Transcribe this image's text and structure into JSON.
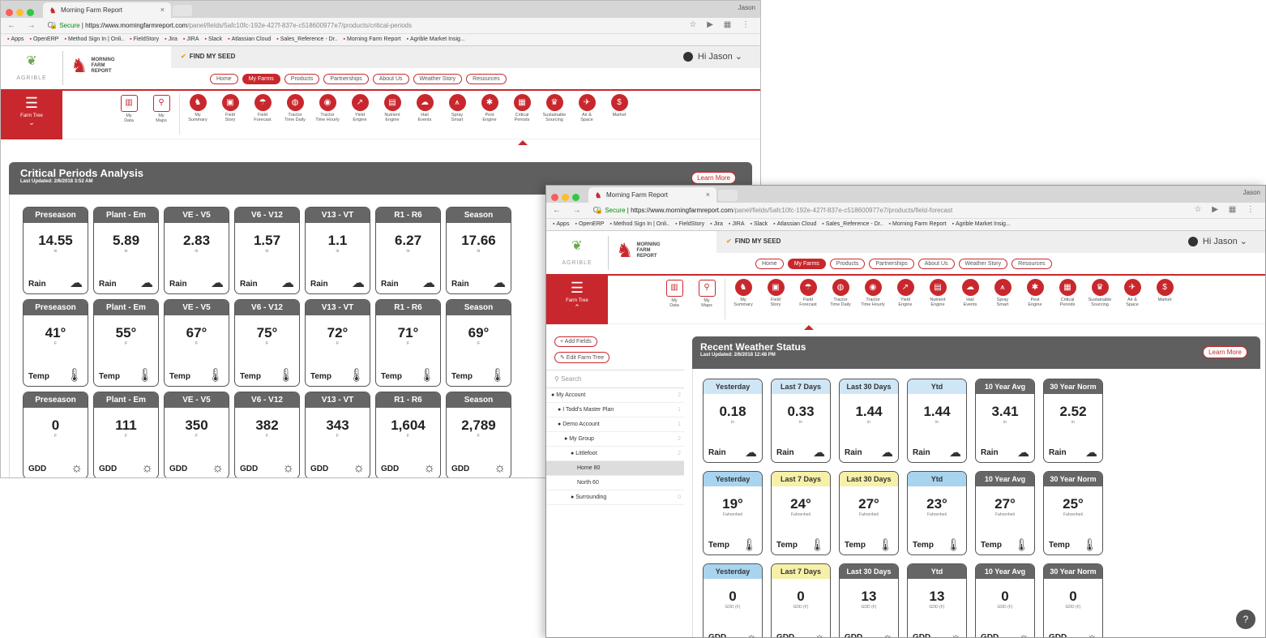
{
  "browser": {
    "tab_title": "Morning Farm Report",
    "user": "Jason",
    "secure": "Secure",
    "url_base": "https://www.morningfarmreport.com",
    "bookmarks": [
      "Apps",
      "OpenERP",
      "Method Sign In | Onli..",
      "FieldStory",
      "Jira",
      "JIRA",
      "Slack",
      "Atlassian Cloud",
      "Sales_Reference - Dr..",
      "Morning Farm Report",
      "Agrible Market Insig..."
    ]
  },
  "header": {
    "agrible": "AGRIBLE",
    "mfr_line1": "MORNING",
    "mfr_line2": "FARM",
    "mfr_line3": "REPORT",
    "find_seed": "FIND MY SEED",
    "greeting": "Hi Jason"
  },
  "menu": [
    "Home",
    "My Farms",
    "Products",
    "Partnerships",
    "About Us",
    "Weather Story",
    "Resources"
  ],
  "farm_tree": "Farm Tree",
  "apps": [
    {
      "l1": "My",
      "l2": "Data",
      "icon": "data-icon",
      "g": "▥"
    },
    {
      "l1": "My",
      "l2": "Maps",
      "icon": "map-pin-icon",
      "g": "⚲"
    },
    {
      "l1": "My",
      "l2": "Summary",
      "icon": "rooster-icon",
      "g": "♞"
    },
    {
      "l1": "Field",
      "l2": "Story",
      "icon": "field-story-icon",
      "g": "▣"
    },
    {
      "l1": "Field",
      "l2": "Forecast",
      "icon": "forecast-icon",
      "g": "☂"
    },
    {
      "l1": "Tractor",
      "l2": "Time Daily",
      "icon": "tractor-icon",
      "g": "◍"
    },
    {
      "l1": "Tractor",
      "l2": "Time Hourly",
      "icon": "tractor-hourly-icon",
      "g": "◉"
    },
    {
      "l1": "Yield",
      "l2": "Engine",
      "icon": "yield-icon",
      "g": "↗"
    },
    {
      "l1": "Nutrient",
      "l2": "Engine",
      "icon": "nutrient-icon",
      "g": "▤"
    },
    {
      "l1": "Hail",
      "l2": "Events",
      "icon": "hail-icon",
      "g": "☁"
    },
    {
      "l1": "Spray",
      "l2": "Smart",
      "icon": "spray-icon",
      "g": "⩚"
    },
    {
      "l1": "Pest",
      "l2": "Engine",
      "icon": "pest-icon",
      "g": "✱"
    },
    {
      "l1": "Critical",
      "l2": "Periods",
      "icon": "calendar-icon",
      "g": "▦"
    },
    {
      "l1": "Sustainable",
      "l2": "Sourcing",
      "icon": "basket-icon",
      "g": "♛"
    },
    {
      "l1": "Air &",
      "l2": "Space",
      "icon": "plane-icon",
      "g": "✈"
    },
    {
      "l1": "Market",
      "l2": "",
      "icon": "market-icon",
      "g": "$"
    }
  ],
  "w1": {
    "url_path": "/panel/fields/5afc10fc-192e-427f-837e-c518600977e7/products/critical-periods",
    "title": "Critical Periods Analysis",
    "updated": "Last Updated: 2/6/2018 3:52 AM",
    "learn": "Learn More",
    "periods": [
      "Preseason",
      "Plant - Em",
      "VE - V5",
      "V6 - V12",
      "V13 - VT",
      "R1 - R6",
      "Season"
    ],
    "rows": [
      {
        "values": [
          "14.55",
          "5.89",
          "2.83",
          "1.57",
          "1.1",
          "6.27",
          "17.66"
        ],
        "unit": "in",
        "label": "Rain",
        "icon": "rain-cloud-icon",
        "glyph": "☁"
      },
      {
        "values": [
          "41°",
          "55°",
          "67°",
          "75°",
          "72°",
          "71°",
          "69°"
        ],
        "unit": "F",
        "label": "Temp",
        "icon": "thermometer-icon",
        "glyph": "🌡"
      },
      {
        "values": [
          "0",
          "111",
          "350",
          "382",
          "343",
          "1,604",
          "2,789"
        ],
        "unit": "F",
        "label": "GDD",
        "icon": "sun-plant-icon",
        "glyph": "☼"
      }
    ]
  },
  "w2": {
    "url_path": "/panel/fields/5afc10fc-192e-427f-837e-c518600977e7/products/field-forecast",
    "title": "Recent Weather Status",
    "updated": "Last Updated: 2/6/2018 12:48 PM",
    "learn": "Learn More",
    "add_fields": "+ Add Fields",
    "edit_tree": "✎ Edit Farm Tree",
    "search": "Search",
    "tree": [
      {
        "label": "My Account",
        "indent": 0,
        "count": "2"
      },
      {
        "label": "I Todd's Master Plan",
        "indent": 1,
        "count": "1"
      },
      {
        "label": "Demo Account",
        "indent": 1,
        "count": "1"
      },
      {
        "label": "My Group",
        "indent": 2,
        "count": "2"
      },
      {
        "label": "Littlefoot",
        "indent": 3,
        "count": "2"
      },
      {
        "label": "Home 80",
        "indent": 4,
        "count": "",
        "hl": true
      },
      {
        "label": "North 60",
        "indent": 4,
        "count": ""
      },
      {
        "label": "Surrounding",
        "indent": 3,
        "count": "0"
      }
    ],
    "periods": [
      "Yesterday",
      "Last 7 Days",
      "Last 30 Days",
      "Ytd",
      "10 Year Avg",
      "30 Year Norm"
    ],
    "rows": [
      {
        "values": [
          "0.18",
          "0.33",
          "1.44",
          "1.44",
          "3.41",
          "2.52"
        ],
        "unit": "in",
        "label": "Rain",
        "colors": [
          "#cfe6f6",
          "#cfe6f6",
          "#cfe6f6",
          "#cfe6f6",
          "#666",
          "#666"
        ],
        "glyph": "☁"
      },
      {
        "values": [
          "19°",
          "24°",
          "27°",
          "23°",
          "27°",
          "25°"
        ],
        "unit": "Fahrenheit",
        "label": "Temp",
        "colors": [
          "#a8d4ef",
          "#f6f0a8",
          "#f6f0a8",
          "#a8d4ef",
          "#666",
          "#666"
        ],
        "glyph": "🌡"
      },
      {
        "values": [
          "0",
          "0",
          "13",
          "13",
          "0",
          "0"
        ],
        "unit": "GDD (F)",
        "label": "GDD",
        "colors": [
          "#a8d4ef",
          "#f6f0a8",
          "#666",
          "#666",
          "#666",
          "#666"
        ],
        "glyph": "☼"
      }
    ]
  },
  "colors": {
    "brand": "#c8282d",
    "panel": "#5f5f5f"
  }
}
